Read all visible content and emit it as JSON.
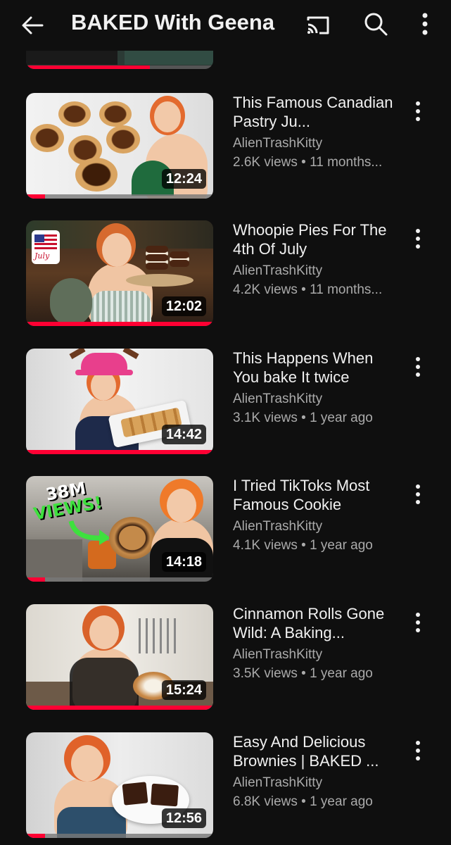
{
  "header": {
    "title": "BAKED With Geena",
    "back_icon": "arrow-left-icon",
    "cast_icon": "cast-icon",
    "search_icon": "search-icon",
    "more_icon": "more-vert-icon"
  },
  "partial_video": {
    "progress": 0.66
  },
  "videos": [
    {
      "title": "This Famous Canadian Pastry Ju...",
      "channel": "AlienTrashKitty",
      "stats": "2.6K views • 11 months...",
      "duration": "12:24",
      "progress": 0.1
    },
    {
      "title": "Whoopie Pies For The 4th Of July",
      "channel": "AlienTrashKitty",
      "stats": "4.2K views • 11 months...",
      "duration": "12:02",
      "progress": 1.0
    },
    {
      "title": "This Happens When You bake It twice",
      "channel": "AlienTrashKitty",
      "stats": "3.1K views • 1 year ago",
      "duration": "14:42",
      "progress": 1.0
    },
    {
      "title": "I Tried TikToks Most Famous Cookie",
      "channel": "AlienTrashKitty",
      "stats": "4.1K views • 1 year ago",
      "duration": "14:18",
      "progress": 0.1
    },
    {
      "title": "Cinnamon Rolls Gone Wild: A Baking...",
      "channel": "AlienTrashKitty",
      "stats": "3.5K views • 1 year ago",
      "duration": "15:24",
      "progress": 1.0
    },
    {
      "title": "Easy And Delicious Brownies | BAKED ...",
      "channel": "AlienTrashKitty",
      "stats": "6.8K views • 1 year ago",
      "duration": "12:56",
      "progress": 0.1
    }
  ],
  "thumbnail_text": {
    "july_badge": "July",
    "views_badge_top": "38M",
    "views_badge_bottom": "VIEWS!"
  },
  "colors": {
    "background": "#0f0f0f",
    "progress": "#ff0033",
    "secondary_text": "#aaaaaa"
  }
}
